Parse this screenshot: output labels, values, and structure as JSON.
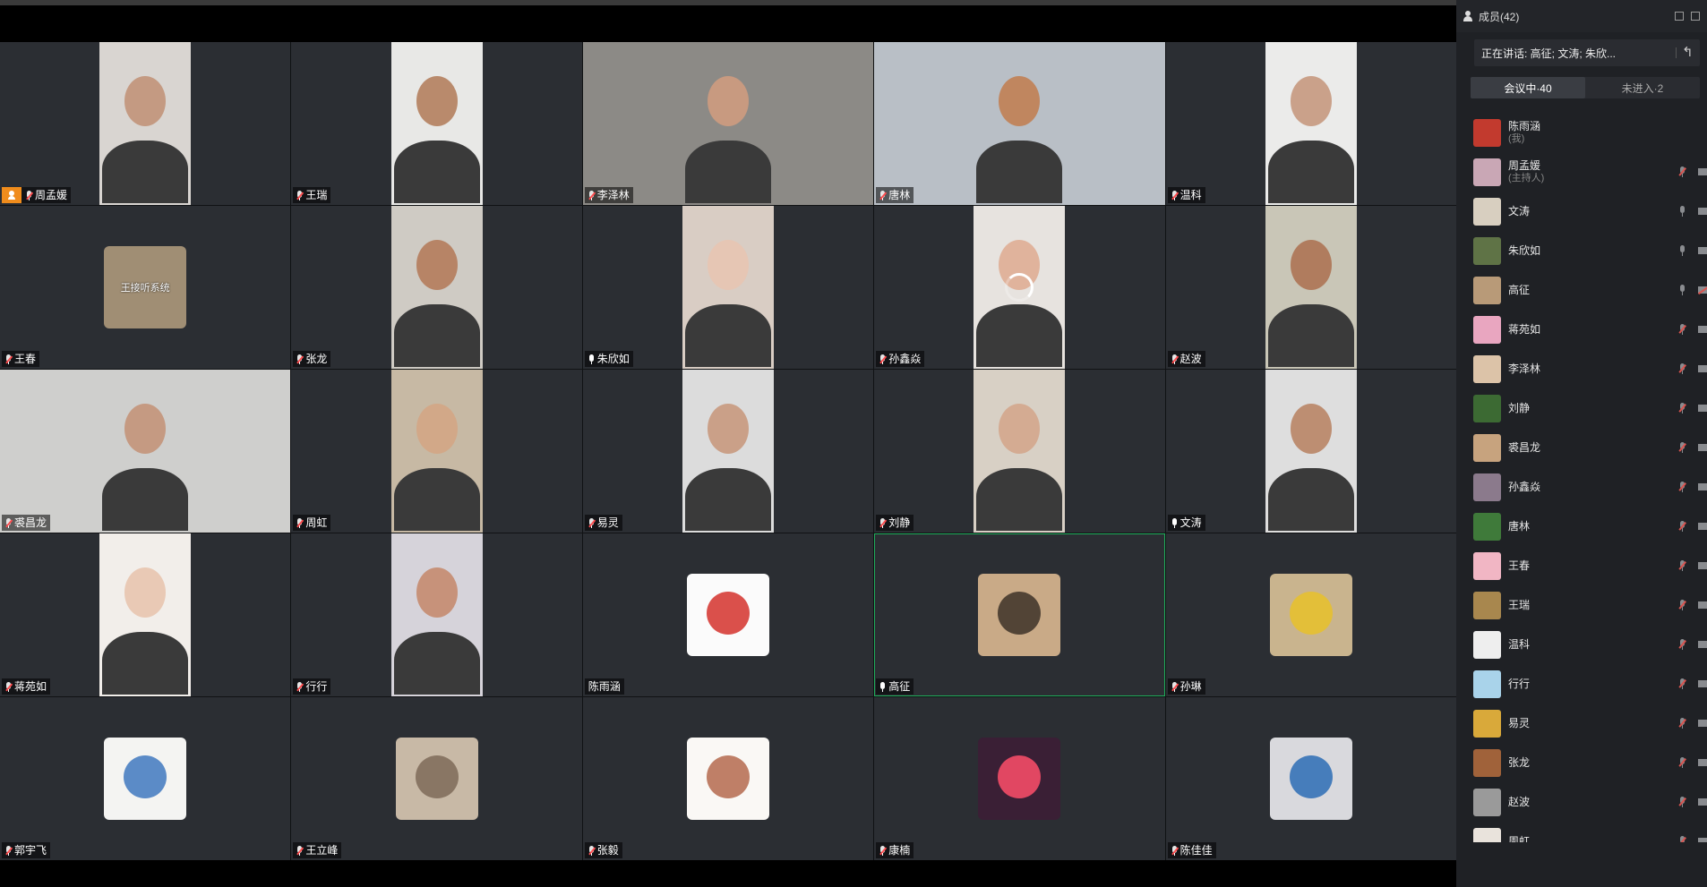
{
  "window": {
    "panel_title": "成员(42)"
  },
  "speaking": {
    "text": "正在讲话: 高征; 文涛; 朱欣..."
  },
  "tabs": [
    {
      "label": "会议中·40"
    },
    {
      "label": "未进入·2"
    }
  ],
  "tiles": [
    {
      "name": "周孟媛",
      "mic": "muted",
      "host": true,
      "kind": "video",
      "bg": "#d9d5d1",
      "skin": "#c49a82"
    },
    {
      "name": "王瑞",
      "mic": "muted",
      "kind": "video",
      "bg": "#e8e8e6",
      "skin": "#b98a6c"
    },
    {
      "name": "李泽林",
      "mic": "muted",
      "kind": "wide",
      "bg": "#8c8a86",
      "skin": "#c89a80"
    },
    {
      "name": "唐林",
      "mic": "muted",
      "kind": "wide",
      "bg": "#b9bfc6",
      "skin": "#c0865f"
    },
    {
      "name": "温科",
      "mic": "muted",
      "kind": "video",
      "bg": "#ebebea",
      "skin": "#caa18a"
    },
    {
      "name": "王春",
      "mic": "muted",
      "kind": "avatar",
      "ava_color": "#a08e74",
      "ava_text": "王接听系统"
    },
    {
      "name": "张龙",
      "mic": "muted",
      "kind": "video",
      "bg": "#cfcbc4",
      "skin": "#b78466"
    },
    {
      "name": "朱欣如",
      "mic": "on",
      "kind": "video",
      "bg": "#d9cdc4",
      "skin": "#e6c6b4"
    },
    {
      "name": "孙鑫焱",
      "mic": "muted",
      "kind": "video",
      "bg": "#e7e3df",
      "skin": "#e0b39c",
      "loading": true
    },
    {
      "name": "赵波",
      "mic": "muted",
      "kind": "video",
      "bg": "#c9c6b7",
      "skin": "#b07c5e"
    },
    {
      "name": "裘昌龙",
      "mic": "muted",
      "kind": "wide",
      "bg": "#cfcfcd",
      "skin": "#c59a82"
    },
    {
      "name": "周虹",
      "mic": "muted",
      "kind": "video",
      "bg": "#c7b9a4",
      "skin": "#d2a888"
    },
    {
      "name": "易灵",
      "mic": "muted",
      "kind": "video",
      "bg": "#dcdcdc",
      "skin": "#caa088"
    },
    {
      "name": "刘静",
      "mic": "muted",
      "kind": "video",
      "bg": "#d8d0c5",
      "skin": "#d4ab92"
    },
    {
      "name": "文涛",
      "mic": "on",
      "kind": "video",
      "bg": "#dedede",
      "skin": "#bd8e72"
    },
    {
      "name": "蒋苑如",
      "mic": "muted",
      "kind": "video",
      "bg": "#f2eeea",
      "skin": "#e9c9b5"
    },
    {
      "name": "行行",
      "mic": "muted",
      "kind": "video",
      "bg": "#d6d3da",
      "skin": "#c7927a"
    },
    {
      "name": "陈雨涵",
      "mic": "none",
      "kind": "avatar",
      "ava_color": "#fbfbfb",
      "ava_accent": "#d3312b"
    },
    {
      "name": "高征",
      "mic": "on",
      "kind": "avatar",
      "ava_color": "#c9aa87",
      "ava_accent": "#3d3328",
      "active": true
    },
    {
      "name": "孙琳",
      "mic": "muted",
      "kind": "avatar",
      "ava_color": "#c9b48e",
      "ava_accent": "#e8c12a"
    },
    {
      "name": "郭宇飞",
      "mic": "muted",
      "kind": "avatar",
      "ava_color": "#f4f4f2",
      "ava_accent": "#3f78c0"
    },
    {
      "name": "王立峰",
      "mic": "muted",
      "kind": "avatar",
      "ava_color": "#c8b9a6",
      "ava_accent": "#7e6a58"
    },
    {
      "name": "张毅",
      "mic": "muted",
      "kind": "avatar",
      "ava_color": "#faf8f5",
      "ava_accent": "#b46a4d"
    },
    {
      "name": "康楠",
      "mic": "muted",
      "kind": "avatar",
      "ava_color": "#3a1f35",
      "ava_accent": "#ff4f6a"
    },
    {
      "name": "陈佳佳",
      "mic": "muted",
      "kind": "avatar",
      "ava_color": "#d9d9dd",
      "ava_accent": "#2b6cb5"
    }
  ],
  "members": [
    {
      "name": "陈雨涵",
      "sub": "(我)",
      "color": "#c23a2e",
      "mic": "none",
      "cam": "none"
    },
    {
      "name": "周孟媛",
      "sub": "(主持人)",
      "color": "#c9a7b5",
      "mic": "muted",
      "cam": "on"
    },
    {
      "name": "文涛",
      "color": "#d8cfc0",
      "mic": "on",
      "cam": "on"
    },
    {
      "name": "朱欣如",
      "color": "#5f7346",
      "mic": "on",
      "cam": "on"
    },
    {
      "name": "高征",
      "color": "#b89a78",
      "mic": "on",
      "cam": "off"
    },
    {
      "name": "蒋苑如",
      "color": "#e9a6c0",
      "mic": "muted",
      "cam": "on"
    },
    {
      "name": "李泽林",
      "color": "#dcc3a8",
      "mic": "muted",
      "cam": "on"
    },
    {
      "name": "刘静",
      "color": "#3c6a33",
      "mic": "muted",
      "cam": "on"
    },
    {
      "name": "裘昌龙",
      "color": "#c7a37e",
      "mic": "muted",
      "cam": "on"
    },
    {
      "name": "孙鑫焱",
      "color": "#8b7a8c",
      "mic": "muted",
      "cam": "on"
    },
    {
      "name": "唐林",
      "color": "#3f7a3a",
      "mic": "muted",
      "cam": "on"
    },
    {
      "name": "王春",
      "color": "#f1b6c4",
      "mic": "muted",
      "cam": "on"
    },
    {
      "name": "王瑞",
      "color": "#a8874e",
      "mic": "muted",
      "cam": "on"
    },
    {
      "name": "温科",
      "color": "#eeeeee",
      "mic": "muted",
      "cam": "on"
    },
    {
      "name": "行行",
      "color": "#a9d3ea",
      "mic": "muted",
      "cam": "on"
    },
    {
      "name": "易灵",
      "color": "#d9a93a",
      "mic": "muted",
      "cam": "on"
    },
    {
      "name": "张龙",
      "color": "#a0623a",
      "mic": "muted",
      "cam": "on"
    },
    {
      "name": "赵波",
      "color": "#9a9a9a",
      "mic": "muted",
      "cam": "on"
    },
    {
      "name": "周虹",
      "color": "#e9e3dc",
      "mic": "muted",
      "cam": "on"
    }
  ]
}
